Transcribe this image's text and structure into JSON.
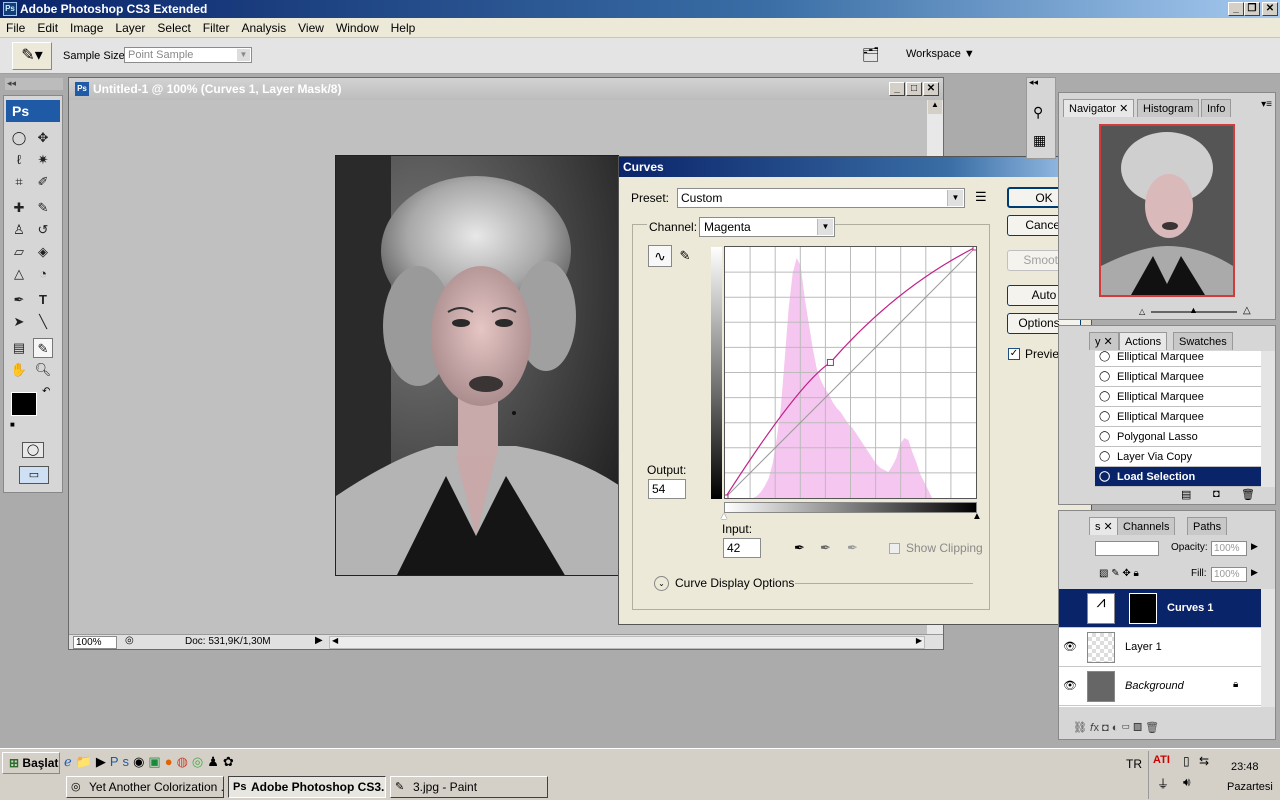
{
  "app": {
    "title": "Adobe Photoshop CS3 Extended",
    "icon_text": "Ps"
  },
  "menu": [
    "File",
    "Edit",
    "Image",
    "Layer",
    "Select",
    "Filter",
    "Analysis",
    "View",
    "Window",
    "Help"
  ],
  "options": {
    "sample_size_label": "Sample Size:",
    "sample_size_value": "Point Sample",
    "workspace_label": "Workspace"
  },
  "toolbox": {
    "logo": "Ps"
  },
  "document": {
    "title": "Untitled-1 @ 100% (Curves 1, Layer Mask/8)",
    "zoom": "100%",
    "doc_info": "Doc: 531,9K/1,30M"
  },
  "curves": {
    "title": "Curves",
    "preset_label": "Preset:",
    "preset_value": "Custom",
    "channel_label": "Channel:",
    "channel_value": "Magenta",
    "output_label": "Output:",
    "output_value": "54",
    "input_label": "Input:",
    "input_value": "42",
    "show_clipping": "Show Clipping",
    "display_options": "Curve Display Options",
    "buttons": {
      "ok": "OK",
      "cancel": "Cancel",
      "smooth": "Smooth",
      "auto": "Auto",
      "options": "Options..."
    },
    "preview_label": "Preview",
    "curve_color": "#c0208a",
    "histogram_color": "#f5c6ef"
  },
  "navigator": {
    "tabs": [
      "Navigator",
      "Histogram",
      "Info"
    ]
  },
  "history": {
    "tabs": [
      "Actions",
      "Swatches"
    ],
    "items": [
      "Elliptical Marquee",
      "Elliptical Marquee",
      "Elliptical Marquee",
      "Elliptical Marquee",
      "Polygonal Lasso",
      "Layer Via Copy",
      "Load Selection"
    ],
    "selected_index": 6
  },
  "layers": {
    "tabs": [
      "Channels",
      "Paths"
    ],
    "opacity_label": "Opacity:",
    "opacity_value": "100%",
    "fill_label": "Fill:",
    "fill_value": "100%",
    "items": [
      {
        "name": "Curves 1",
        "selected": true
      },
      {
        "name": "Layer 1",
        "selected": false
      },
      {
        "name": "Background",
        "selected": false,
        "italic": true
      }
    ]
  },
  "taskbar": {
    "start": "Başlat",
    "tasks": [
      {
        "label": "Yet Another Colorization ...",
        "active": false
      },
      {
        "label": "Adobe Photoshop CS3...",
        "active": true
      },
      {
        "label": "3.jpg - Paint",
        "active": false
      }
    ],
    "lang": "TR",
    "time": "23:48",
    "day": "Pazartesi"
  }
}
